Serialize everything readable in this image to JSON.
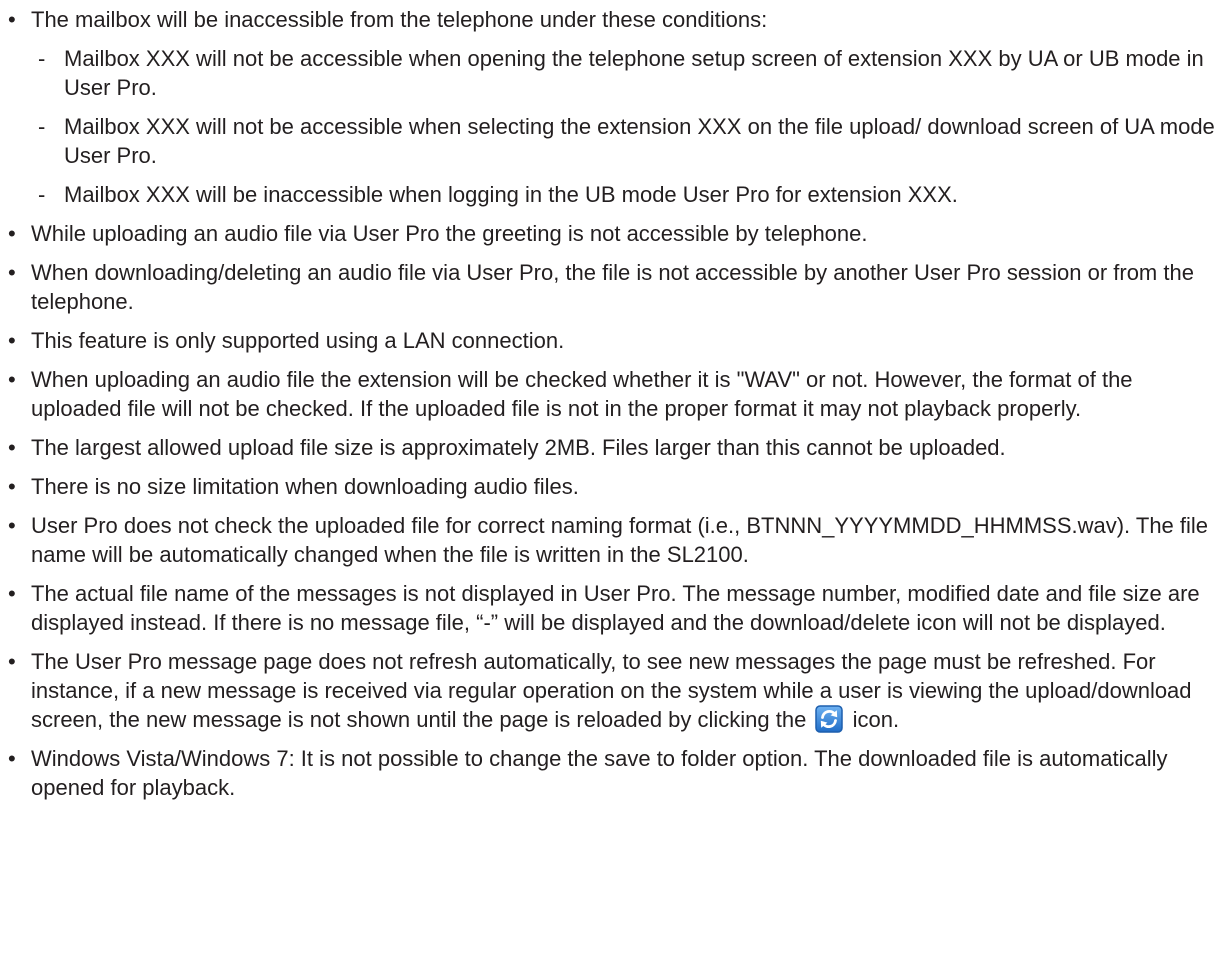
{
  "bullet_char": "•",
  "dash_char": "-",
  "items": [
    {
      "text": "The mailbox will be inaccessible from the telephone under these conditions:",
      "subitems": [
        "Mailbox XXX will not be accessible when opening the telephone setup screen of extension XXX by UA or UB mode in User Pro.",
        "Mailbox XXX will not be accessible when selecting the extension XXX on the file upload/ download screen of UA mode User Pro.",
        "Mailbox XXX will be inaccessible when logging in the UB mode User Pro for extension XXX."
      ]
    },
    {
      "text": "While uploading an audio file via User Pro the greeting is not accessible by telephone."
    },
    {
      "text": "When downloading/deleting an audio file via User Pro, the file is not accessible by another User Pro session or from the telephone."
    },
    {
      "text": "This feature is only supported using a LAN connection."
    },
    {
      "text": "When uploading an audio file the extension will be checked whether it is \"WAV\" or not. However, the format of the uploaded file will not be checked. If the uploaded file is not in the proper format it may not playback properly."
    },
    {
      "text": "The largest allowed upload file size is approximately 2MB. Files larger than this cannot be uploaded."
    },
    {
      "text": "There is no size limitation when downloading audio files."
    },
    {
      "text": "User Pro does not check the uploaded file for correct naming format (i.e., BTNNN_YYYYMMDD_HHMMSS.wav). The file name will be automatically changed when the file is written in the SL2100."
    },
    {
      "text": "The actual file name of the messages is not displayed in User Pro. The message number, modified date and file size are displayed instead. If there is no message file, “-” will be displayed and the download/delete icon will not be displayed."
    },
    {
      "text_before_icon": "The User Pro message page does not refresh automatically, to see new messages the page must be refreshed. For instance, if a new message is received via regular operation on the system while a user is viewing the upload/download screen, the new message is not shown until the page is reloaded by clicking the",
      "icon": "refresh-icon",
      "text_after_icon": "icon."
    },
    {
      "text": "Windows Vista/Windows 7: It is not possible to change the save to folder option. The downloaded file is automatically opened for playback."
    }
  ],
  "colors": {
    "text": "#231f20",
    "icon_blue": "#2f7fd6",
    "icon_border": "#1d5fae"
  }
}
